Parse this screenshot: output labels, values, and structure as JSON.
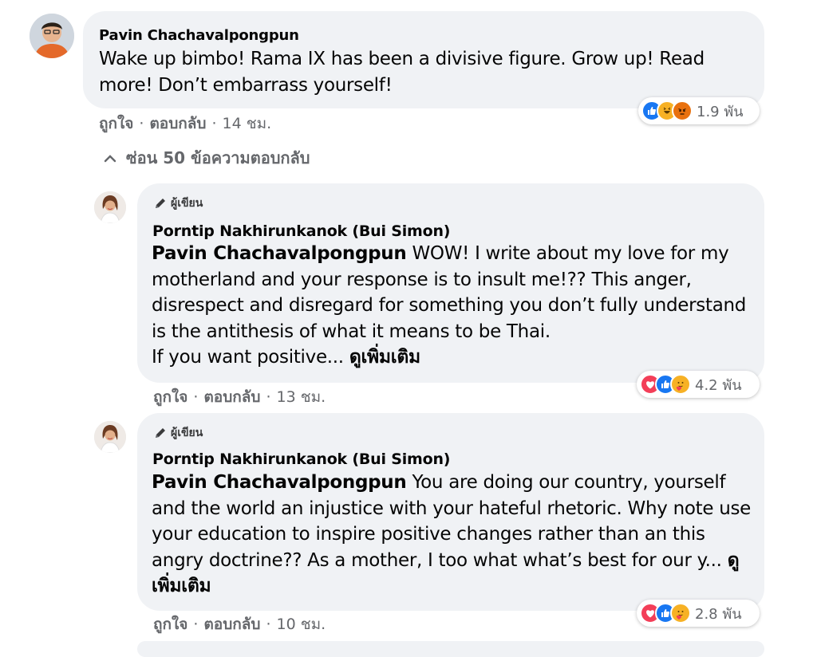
{
  "colors": {
    "bubble_bg": "#f0f2f5",
    "secondary_text": "#65676b",
    "like_blue": "#1877f2",
    "love_red": "#f33e58",
    "haha_yellow": "#f7b125"
  },
  "comment1": {
    "author": "Pavin Chachavalpongpun",
    "text": "Wake up bimbo! Rama IX has been a divisive figure. Grow up! Read more! Don’t embarrass yourself!",
    "like_label": "ถูกใจ",
    "reply_label": "ตอบกลับ",
    "time": "14 ชม.",
    "reaction_count": "1.9 พัน",
    "reaction_icons": [
      "like-icon",
      "haha-icon",
      "angry-icon"
    ]
  },
  "hide_replies_label": "ซ่อน 50 ข้อความตอบกลับ",
  "reply1": {
    "badge": "ผู้เขียน",
    "author": "Porntip Nakhirunkanok (Bui Simon)",
    "mention": "Pavin Chachavalpongpun",
    "text_line1": " WOW! I write about my love for my motherland and your response is to insult me!?? This anger, disrespect and disregard for something you don’t fully understand is the antithesis of what it means to be Thai.",
    "text_line2": "If you want positive...",
    "see_more": "ดูเพิ่มเติม",
    "like_label": "ถูกใจ",
    "reply_label": "ตอบกลับ",
    "time": "13 ชม.",
    "reaction_count": "4.2 พัน",
    "reaction_icons": [
      "love-icon",
      "like-icon",
      "care-icon"
    ]
  },
  "reply2": {
    "badge": "ผู้เขียน",
    "author": "Porntip Nakhirunkanok (Bui Simon)",
    "mention": "Pavin Chachavalpongpun",
    "text": " You are doing our country, yourself and the world an injustice with your hateful rhetoric. Why note use your education to inspire positive changes rather than an this angry doctrine?? As a mother, I too what what’s best for our y...",
    "see_more": "ดูเพิ่มเติม",
    "like_label": "ถูกใจ",
    "reply_label": "ตอบกลับ",
    "time": "10 ชม.",
    "reaction_count": "2.8 พัน",
    "reaction_icons": [
      "love-icon",
      "like-icon",
      "care-icon"
    ]
  }
}
